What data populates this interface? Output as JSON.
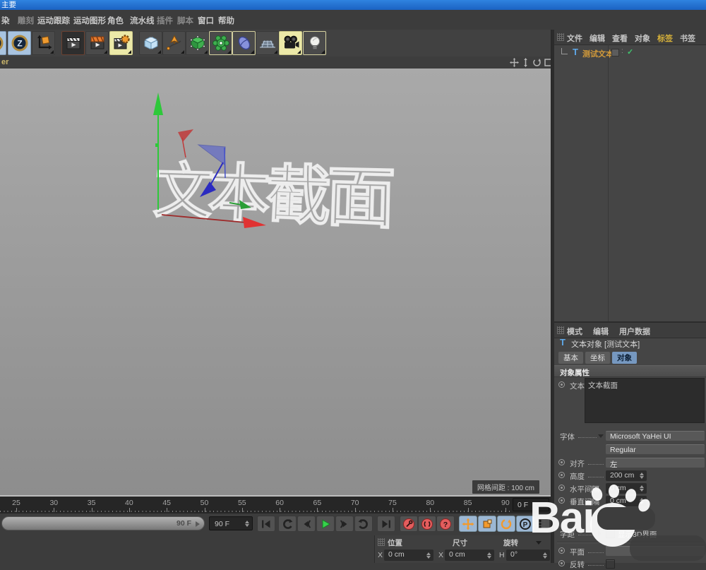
{
  "window": {
    "title": "主要"
  },
  "menubar": {
    "items": [
      "染",
      "雕刻",
      "运动跟踪",
      "运动图形",
      "角色",
      "流水线",
      "插件",
      "脚本",
      "窗口",
      "帮助"
    ]
  },
  "toolbar": {
    "icons": [
      "circled-history-icon",
      "circled-z-icon",
      "axis-move-icon",
      "render-view-icon",
      "render-picture-viewer-icon",
      "render-settings-icon",
      "cube-primitive-icon",
      "pen-spline-icon",
      "generator-cube-icon",
      "deformer-gear-icon",
      "spline-blob-icon",
      "floor-grid-icon",
      "camera-icon",
      "light-icon"
    ]
  },
  "viewport": {
    "header_label": "er",
    "nav_icons": [
      "pan-icon",
      "zoom-icon",
      "rotate-icon",
      "maximize-icon"
    ],
    "wireframe_text": "文本截面",
    "grid_label": "网格间距 : 100 cm"
  },
  "object_manager": {
    "menu": [
      "文件",
      "编辑",
      "查看",
      "对象",
      "标签",
      "书签"
    ],
    "highlighted_menu": "标签",
    "object": {
      "name": "测试文本",
      "type_icon": "text-spline-icon",
      "enabled_mark": "✓"
    }
  },
  "attribute_manager": {
    "menu": [
      "模式",
      "编辑",
      "用户数据"
    ],
    "object_title": "文本对象 [测试文本]",
    "tabs": [
      "基本",
      "坐标",
      "对象"
    ],
    "active_tab": "对象",
    "section_title": "对象属性",
    "rows": {
      "text": {
        "label": "文本",
        "value": "文本截面"
      },
      "font": {
        "label": "字体",
        "family": "Microsoft YaHei UI",
        "style": "Regular"
      },
      "align": {
        "label": "对齐",
        "value": "左"
      },
      "height": {
        "label": "高度",
        "value": "200 cm"
      },
      "hspacing": {
        "label": "水平间隔",
        "value": "0 cm"
      },
      "vspacing": {
        "label": "垂直间隔",
        "value": "0 cm"
      },
      "kerning": {
        "label": "字距",
        "checkbox_label": "显示3D界面",
        "checked": false
      },
      "plane": {
        "label": "平面",
        "value": ""
      },
      "reverse": {
        "label": "反转",
        "checked": false
      }
    }
  },
  "timeline": {
    "ticks": [
      25,
      30,
      35,
      40,
      45,
      50,
      55,
      60,
      65,
      70,
      75,
      80,
      85,
      90
    ],
    "range_label": "90 F",
    "frame_spinner": "90 F",
    "current_frame": "0 F"
  },
  "transport": {
    "icons": [
      "goto-start-icon",
      "play-backward-icon",
      "prev-frame-icon",
      "play-icon",
      "next-frame-icon",
      "loop-icon",
      "goto-end-icon",
      "record-keyframe-icon",
      "autokey-icon",
      "record-question-icon",
      "move-tool-icon",
      "scale-tool-icon",
      "rotate-tool-icon",
      "coord-system-icon",
      "snap-grid-icon",
      "layer-bars-icon"
    ]
  },
  "coordinates": {
    "headers": [
      "位置",
      "尺寸",
      "旋转"
    ],
    "fields": [
      {
        "axis": "X",
        "value": "0 cm"
      },
      {
        "axis": "X",
        "value": "0 cm"
      },
      {
        "axis": "H",
        "value": "0°"
      }
    ]
  },
  "watermark": {
    "text": "Bai"
  },
  "colors": {
    "titlebar_blue": "#1e6ecf",
    "panel_gray": "#454545",
    "selected_object_orange": "#d29a3a",
    "highlight_menu_yellow": "#d8b23a",
    "active_tab_blue": "#7698c0",
    "play_green": "#35d24a",
    "record_red": "#e35d5d",
    "tool_orange": "#f29a2e",
    "tool_blue_bg": "#9cb7d4",
    "check_green": "#42c16e"
  }
}
